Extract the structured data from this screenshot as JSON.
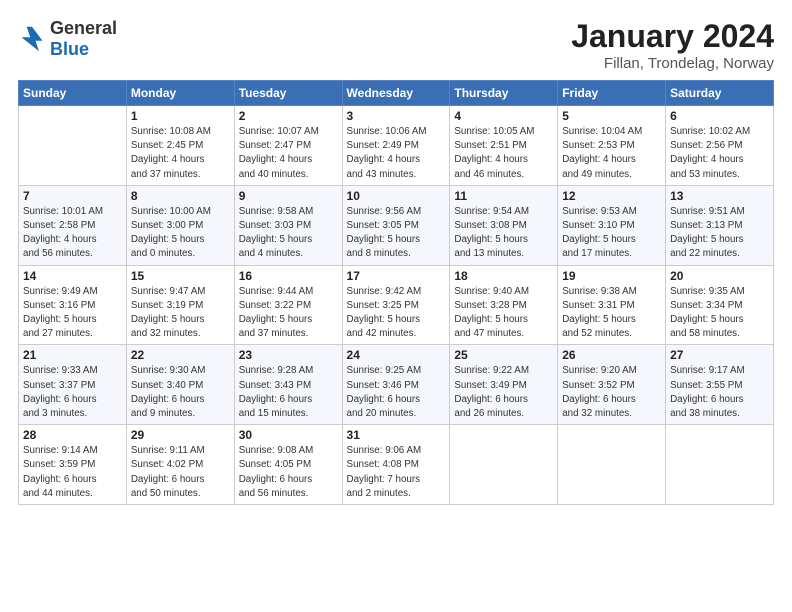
{
  "logo": {
    "general": "General",
    "blue": "Blue"
  },
  "title": "January 2024",
  "subtitle": "Fillan, Trondelag, Norway",
  "weekdays": [
    "Sunday",
    "Monday",
    "Tuesday",
    "Wednesday",
    "Thursday",
    "Friday",
    "Saturday"
  ],
  "weeks": [
    [
      {
        "day": "",
        "info": ""
      },
      {
        "day": "1",
        "info": "Sunrise: 10:08 AM\nSunset: 2:45 PM\nDaylight: 4 hours\nand 37 minutes."
      },
      {
        "day": "2",
        "info": "Sunrise: 10:07 AM\nSunset: 2:47 PM\nDaylight: 4 hours\nand 40 minutes."
      },
      {
        "day": "3",
        "info": "Sunrise: 10:06 AM\nSunset: 2:49 PM\nDaylight: 4 hours\nand 43 minutes."
      },
      {
        "day": "4",
        "info": "Sunrise: 10:05 AM\nSunset: 2:51 PM\nDaylight: 4 hours\nand 46 minutes."
      },
      {
        "day": "5",
        "info": "Sunrise: 10:04 AM\nSunset: 2:53 PM\nDaylight: 4 hours\nand 49 minutes."
      },
      {
        "day": "6",
        "info": "Sunrise: 10:02 AM\nSunset: 2:56 PM\nDaylight: 4 hours\nand 53 minutes."
      }
    ],
    [
      {
        "day": "7",
        "info": "Sunrise: 10:01 AM\nSunset: 2:58 PM\nDaylight: 4 hours\nand 56 minutes."
      },
      {
        "day": "8",
        "info": "Sunrise: 10:00 AM\nSunset: 3:00 PM\nDaylight: 5 hours\nand 0 minutes."
      },
      {
        "day": "9",
        "info": "Sunrise: 9:58 AM\nSunset: 3:03 PM\nDaylight: 5 hours\nand 4 minutes."
      },
      {
        "day": "10",
        "info": "Sunrise: 9:56 AM\nSunset: 3:05 PM\nDaylight: 5 hours\nand 8 minutes."
      },
      {
        "day": "11",
        "info": "Sunrise: 9:54 AM\nSunset: 3:08 PM\nDaylight: 5 hours\nand 13 minutes."
      },
      {
        "day": "12",
        "info": "Sunrise: 9:53 AM\nSunset: 3:10 PM\nDaylight: 5 hours\nand 17 minutes."
      },
      {
        "day": "13",
        "info": "Sunrise: 9:51 AM\nSunset: 3:13 PM\nDaylight: 5 hours\nand 22 minutes."
      }
    ],
    [
      {
        "day": "14",
        "info": "Sunrise: 9:49 AM\nSunset: 3:16 PM\nDaylight: 5 hours\nand 27 minutes."
      },
      {
        "day": "15",
        "info": "Sunrise: 9:47 AM\nSunset: 3:19 PM\nDaylight: 5 hours\nand 32 minutes."
      },
      {
        "day": "16",
        "info": "Sunrise: 9:44 AM\nSunset: 3:22 PM\nDaylight: 5 hours\nand 37 minutes."
      },
      {
        "day": "17",
        "info": "Sunrise: 9:42 AM\nSunset: 3:25 PM\nDaylight: 5 hours\nand 42 minutes."
      },
      {
        "day": "18",
        "info": "Sunrise: 9:40 AM\nSunset: 3:28 PM\nDaylight: 5 hours\nand 47 minutes."
      },
      {
        "day": "19",
        "info": "Sunrise: 9:38 AM\nSunset: 3:31 PM\nDaylight: 5 hours\nand 52 minutes."
      },
      {
        "day": "20",
        "info": "Sunrise: 9:35 AM\nSunset: 3:34 PM\nDaylight: 5 hours\nand 58 minutes."
      }
    ],
    [
      {
        "day": "21",
        "info": "Sunrise: 9:33 AM\nSunset: 3:37 PM\nDaylight: 6 hours\nand 3 minutes."
      },
      {
        "day": "22",
        "info": "Sunrise: 9:30 AM\nSunset: 3:40 PM\nDaylight: 6 hours\nand 9 minutes."
      },
      {
        "day": "23",
        "info": "Sunrise: 9:28 AM\nSunset: 3:43 PM\nDaylight: 6 hours\nand 15 minutes."
      },
      {
        "day": "24",
        "info": "Sunrise: 9:25 AM\nSunset: 3:46 PM\nDaylight: 6 hours\nand 20 minutes."
      },
      {
        "day": "25",
        "info": "Sunrise: 9:22 AM\nSunset: 3:49 PM\nDaylight: 6 hours\nand 26 minutes."
      },
      {
        "day": "26",
        "info": "Sunrise: 9:20 AM\nSunset: 3:52 PM\nDaylight: 6 hours\nand 32 minutes."
      },
      {
        "day": "27",
        "info": "Sunrise: 9:17 AM\nSunset: 3:55 PM\nDaylight: 6 hours\nand 38 minutes."
      }
    ],
    [
      {
        "day": "28",
        "info": "Sunrise: 9:14 AM\nSunset: 3:59 PM\nDaylight: 6 hours\nand 44 minutes."
      },
      {
        "day": "29",
        "info": "Sunrise: 9:11 AM\nSunset: 4:02 PM\nDaylight: 6 hours\nand 50 minutes."
      },
      {
        "day": "30",
        "info": "Sunrise: 9:08 AM\nSunset: 4:05 PM\nDaylight: 6 hours\nand 56 minutes."
      },
      {
        "day": "31",
        "info": "Sunrise: 9:06 AM\nSunset: 4:08 PM\nDaylight: 7 hours\nand 2 minutes."
      },
      {
        "day": "",
        "info": ""
      },
      {
        "day": "",
        "info": ""
      },
      {
        "day": "",
        "info": ""
      }
    ]
  ]
}
